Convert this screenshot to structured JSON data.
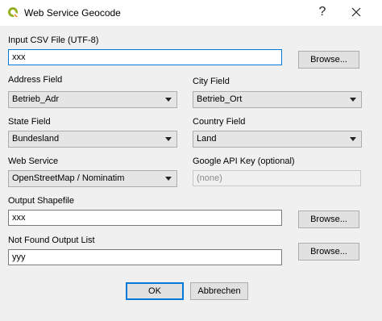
{
  "window": {
    "title": "Web Service Geocode",
    "help_glyph": "?",
    "icon": "qgis-logo-icon",
    "close_icon": "close-icon"
  },
  "fields": {
    "input_csv": {
      "label": "Input CSV File (UTF-8)",
      "value": "xxx"
    },
    "address_field": {
      "label": "Address Field",
      "value": "Betrieb_Adr"
    },
    "city_field": {
      "label": "City Field",
      "value": "Betrieb_Ort"
    },
    "state_field": {
      "label": "State Field",
      "value": "Bundesland"
    },
    "country_field": {
      "label": "Country Field",
      "value": "Land"
    },
    "web_service": {
      "label": "Web Service",
      "value": "OpenStreetMap / Nominatim"
    },
    "api_key": {
      "label": "Google API Key (optional)",
      "placeholder": "(none)"
    },
    "output_shapefile": {
      "label": "Output Shapefile",
      "value": "xxx"
    },
    "not_found_list": {
      "label": "Not Found Output List",
      "value": "yyy"
    }
  },
  "buttons": {
    "browse": "Browse...",
    "ok": "OK",
    "cancel": "Abbrechen"
  },
  "colors": {
    "accent": "#0078d7",
    "dialog_bg": "#f0f0f0"
  }
}
